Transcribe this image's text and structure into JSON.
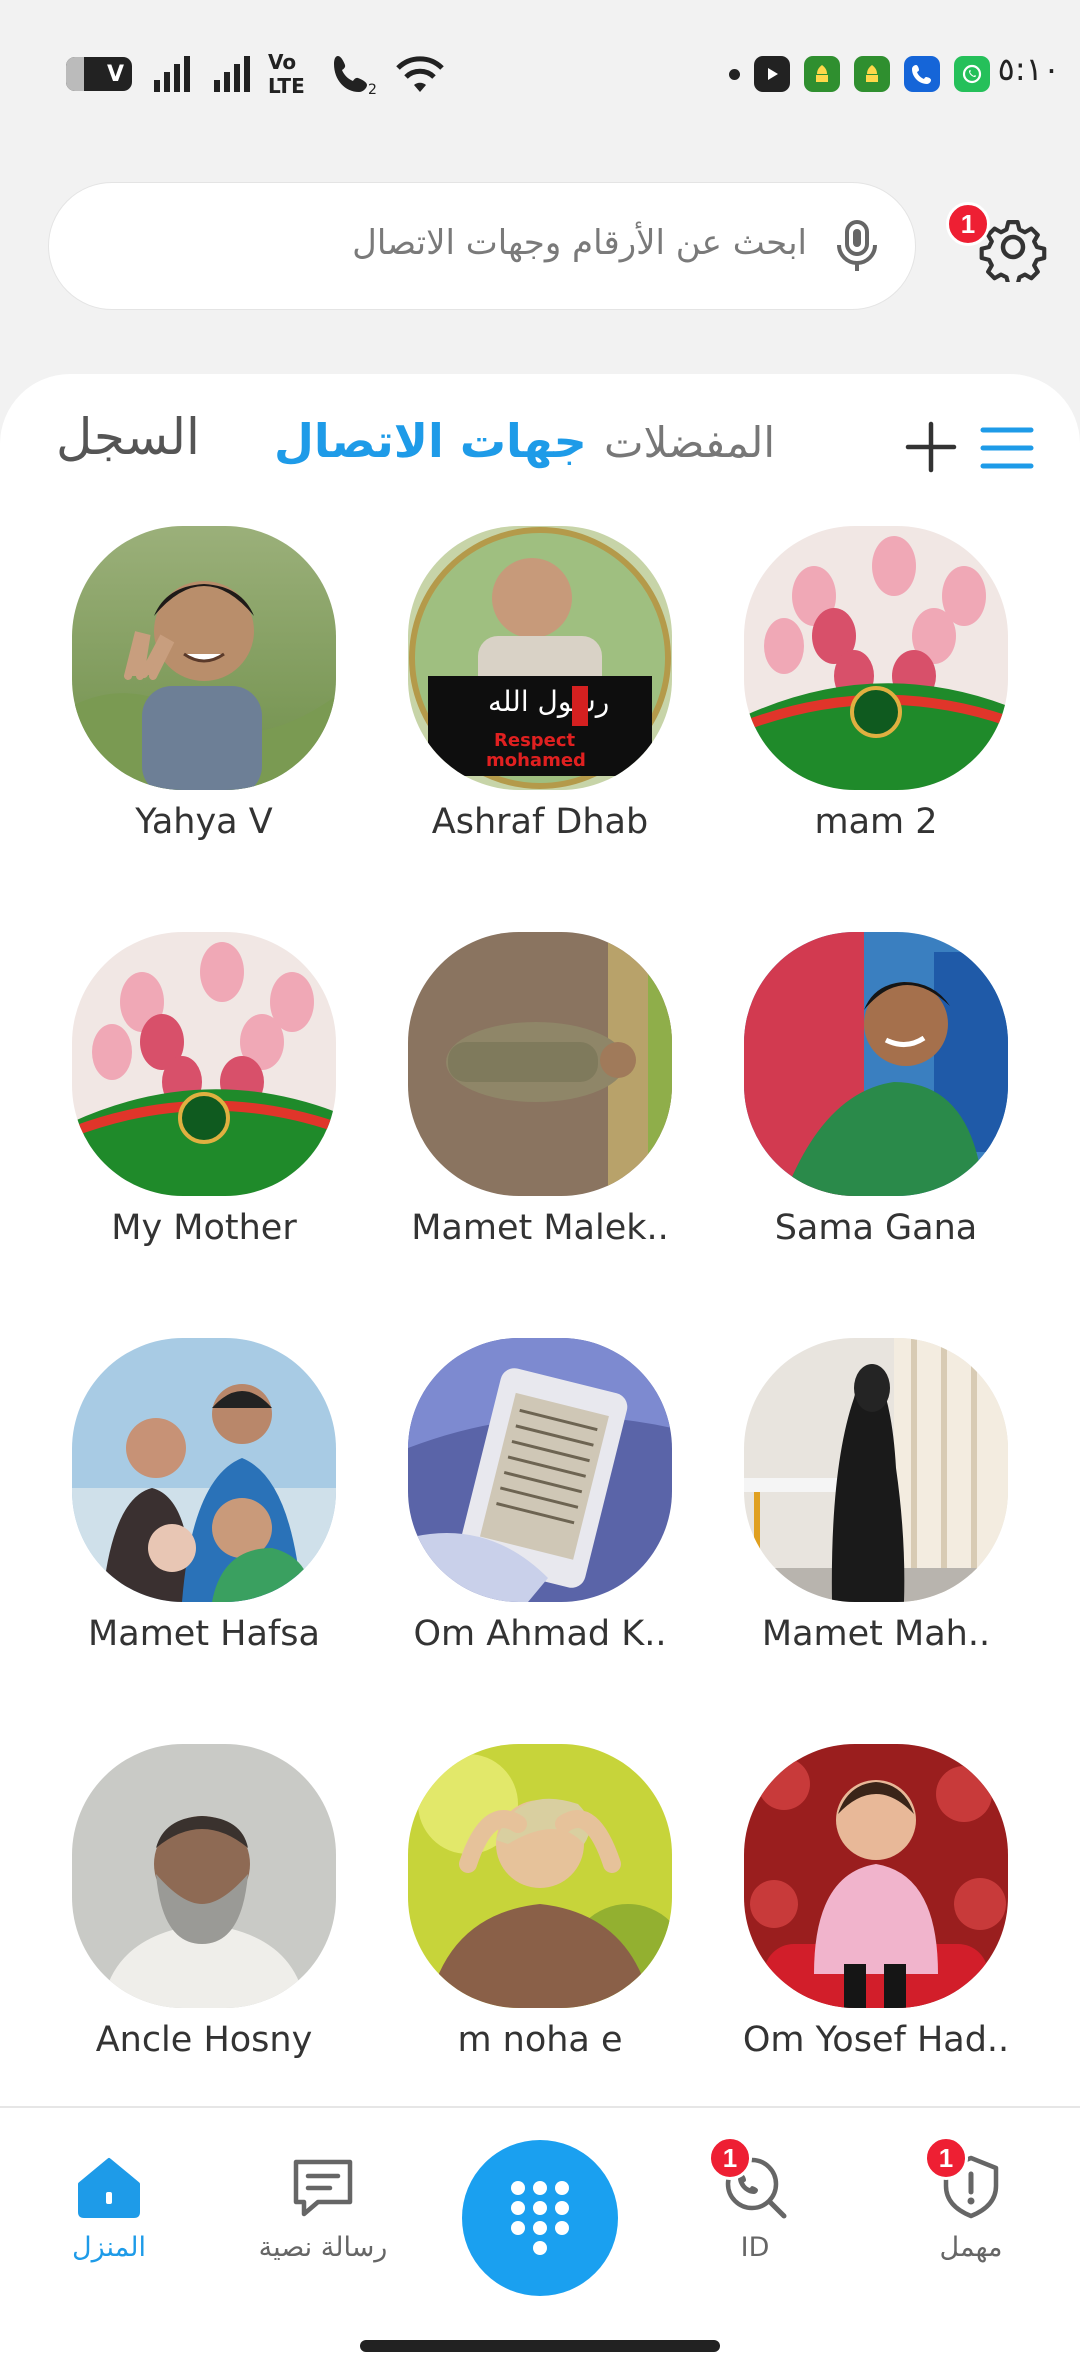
{
  "status_bar": {
    "battery": "V",
    "volte": [
      "Vo",
      "LTE"
    ],
    "time": "٥:١٠"
  },
  "search": {
    "placeholder": "ابحث عن الأرقام وجهات الاتصال",
    "settings_badge": "1"
  },
  "tabs": {
    "log": "السجل",
    "contacts": "جهات الاتصال",
    "favorites": "المفضلات"
  },
  "contacts": [
    {
      "name": "Yahya V"
    },
    {
      "name": "Ashraf Dhab"
    },
    {
      "name": "mam 2"
    },
    {
      "name": "My Mother"
    },
    {
      "name": "Mamet Malek.."
    },
    {
      "name": "Sama Gana"
    },
    {
      "name": "Mamet Hafsa"
    },
    {
      "name": "Om Ahmad K.."
    },
    {
      "name": "Mamet Mah.."
    },
    {
      "name": "Ancle Hosny"
    },
    {
      "name": "m noha e"
    },
    {
      "name": "Om Yosef Had.."
    }
  ],
  "avatar_texts": {
    "rasool": "رسول الله",
    "respect": "Respect",
    "mohamed": "mohamed"
  },
  "bottom_nav": {
    "home": "المنزل",
    "messages": "رسالة نصية",
    "id": "ID",
    "spam": "مهمل",
    "id_badge": "1",
    "spam_badge": "1"
  },
  "colors": {
    "accent": "#1e9be8",
    "badge": "#ee1f33",
    "dial": "#1aa0f0"
  }
}
